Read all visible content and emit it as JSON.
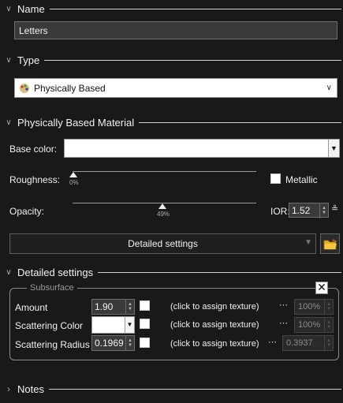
{
  "sections": {
    "name": "Name",
    "type": "Type",
    "material": "Physically Based Material",
    "detailed": "Detailed settings",
    "notes": "Notes"
  },
  "name_field": {
    "value": "Letters"
  },
  "type_select": {
    "value": "Physically Based",
    "icon": "material-palette-icon"
  },
  "base_color": {
    "label": "Base color:",
    "swatch": "#ffffff"
  },
  "roughness": {
    "label": "Roughness:",
    "value_text": "0%",
    "value": 0.0
  },
  "metallic": {
    "label": "Metallic"
  },
  "opacity": {
    "label": "Opacity:",
    "value_text": "49%",
    "value": 0.49
  },
  "ior": {
    "label": "IOR:",
    "value": "1.52"
  },
  "detailed_button": {
    "label": "Detailed settings"
  },
  "subsurface": {
    "title": "Subsurface",
    "rows": [
      {
        "label": "Amount",
        "value": "1.90",
        "texture": "(click to assign texture)",
        "percent": "100%"
      },
      {
        "label": "Scattering Color",
        "value": "",
        "texture": "(click to assign texture)",
        "percent": "100%"
      },
      {
        "label": "Scattering Radius",
        "value": "0.1969",
        "texture": "(click to assign texture)",
        "percent": "0.3937"
      }
    ]
  },
  "colors": {
    "background": "#191919",
    "field": "#3a3a3a",
    "accent_folder": "#e8b020"
  }
}
